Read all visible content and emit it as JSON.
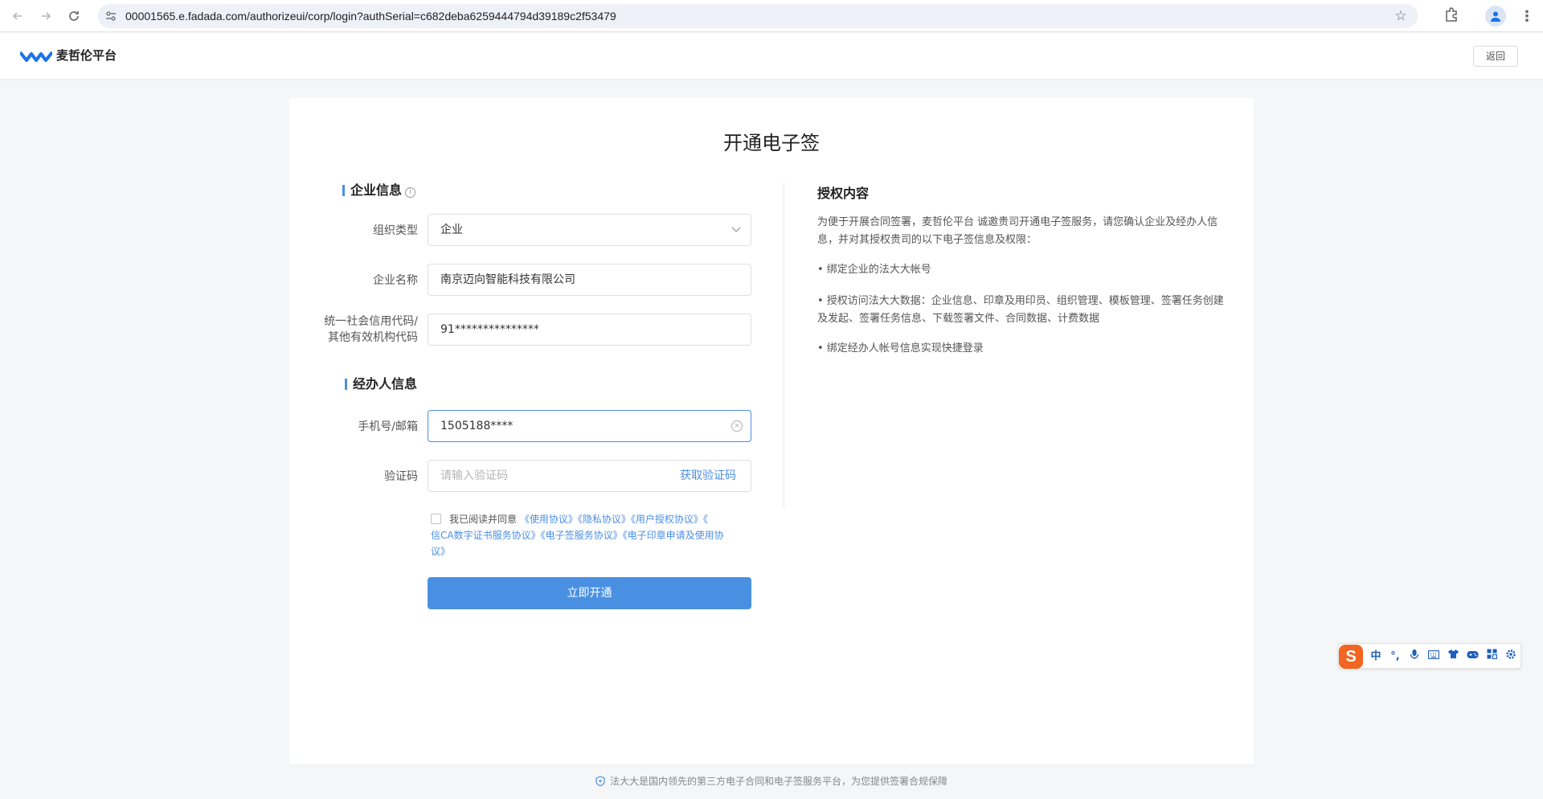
{
  "browser": {
    "url": "00001565.e.fadada.com/authorizeui/corp/login?authSerial=c682deba6259444794d39189c2f53479"
  },
  "header": {
    "brand": "麦哲伦平台",
    "back_label": "返回",
    "brand_color": "#1a73e8"
  },
  "page": {
    "title": "开通电子签"
  },
  "company_section": {
    "title": "企业信息",
    "fields": {
      "org_type": {
        "label": "组织类型",
        "value": "企业"
      },
      "company_name": {
        "label": "企业名称",
        "value": "南京迈向智能科技有限公司"
      },
      "credit_code": {
        "label_line1": "统一社会信用代码/",
        "label_line2": "其他有效机构代码",
        "value": "91***************"
      }
    }
  },
  "agent_section": {
    "title": "经办人信息",
    "fields": {
      "phone": {
        "label": "手机号/邮箱",
        "value": "1505188****"
      },
      "code": {
        "label": "验证码",
        "placeholder": "请输入验证码",
        "action": "获取验证码"
      }
    }
  },
  "agreement": {
    "prefix": "我已阅读并同意",
    "links": [
      "《使用协议》",
      "《隐私协议》",
      "《用户授权协议》",
      "《",
      "信CA数字证书服务协议》",
      "《电子签服务协议》",
      "《电子印章申请及使用协",
      "议》"
    ]
  },
  "submit_label": "立即开通",
  "auth": {
    "title": "授权内容",
    "intro": "为便于开展合同签署，麦哲伦平台 诚邀贵司开通电子签服务，请您确认企业及经办人信息，并对其授权贵司的以下电子签信息及权限：",
    "items": [
      "• 绑定企业的法大大帐号",
      "• 授权访问法大大数据：企业信息、印章及用印员、组织管理、模板管理、签署任务创建及发起、签署任务信息、下载签署文件、合同数据、计费数据",
      "• 绑定经办人帐号信息实现快捷登录"
    ]
  },
  "footer": {
    "text": "法大大是国内领先的第三方电子合同和电子签服务平台，为您提供签署合规保障"
  },
  "ime": {
    "logo": "S",
    "mode": "中",
    "punct": "°,",
    "accent_color": "#f26522"
  },
  "colors": {
    "primary": "#4a90e2",
    "link": "#4a8fe7",
    "page_bg": "#f5f6f7"
  }
}
